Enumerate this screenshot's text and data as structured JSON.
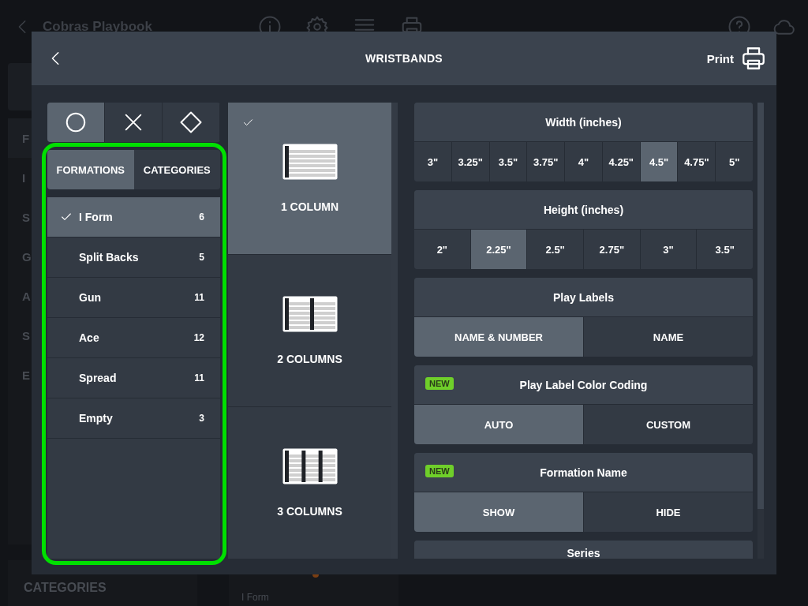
{
  "background": {
    "title": "Cobras Playbook",
    "sidebar_items": [
      {
        "label": "F",
        "kind": "header"
      },
      {
        "label": "I",
        "kind": "item"
      },
      {
        "label": "S",
        "kind": "item"
      },
      {
        "label": "G",
        "kind": "item"
      },
      {
        "label": "A",
        "kind": "item"
      },
      {
        "label": "S",
        "kind": "item"
      },
      {
        "label": "E",
        "kind": "item"
      }
    ],
    "categories_label": "CATEGORIES",
    "card": {
      "formation": "I Form"
    }
  },
  "dialog": {
    "title": "WRISTBANDS",
    "print_label": "Print"
  },
  "shape_tabs": [
    {
      "kind": "circle",
      "selected": true
    },
    {
      "kind": "cross",
      "selected": false
    },
    {
      "kind": "diamond",
      "selected": false
    }
  ],
  "list_tabs": [
    {
      "label": "FORMATIONS",
      "selected": true
    },
    {
      "label": "CATEGORIES",
      "selected": false
    }
  ],
  "formations": [
    {
      "name": "I Form",
      "count": "6",
      "selected": true
    },
    {
      "name": "Split Backs",
      "count": "5",
      "selected": false
    },
    {
      "name": "Gun",
      "count": "11",
      "selected": false
    },
    {
      "name": "Ace",
      "count": "12",
      "selected": false
    },
    {
      "name": "Spread",
      "count": "11",
      "selected": false
    },
    {
      "name": "Empty",
      "count": "3",
      "selected": false
    }
  ],
  "layouts": [
    {
      "label": "1 COLUMN",
      "kind": "one",
      "selected": true
    },
    {
      "label": "2 COLUMNS",
      "kind": "two",
      "selected": false
    },
    {
      "label": "3 COLUMNS",
      "kind": "three",
      "selected": false
    }
  ],
  "settings": [
    {
      "title": "Width (inches)",
      "new": false,
      "options": [
        {
          "label": "3\"",
          "selected": false
        },
        {
          "label": "3.25\"",
          "selected": false
        },
        {
          "label": "3.5\"",
          "selected": false
        },
        {
          "label": "3.75\"",
          "selected": false
        },
        {
          "label": "4\"",
          "selected": false
        },
        {
          "label": "4.25\"",
          "selected": false
        },
        {
          "label": "4.5\"",
          "selected": true
        },
        {
          "label": "4.75\"",
          "selected": false
        },
        {
          "label": "5\"",
          "selected": false
        }
      ]
    },
    {
      "title": "Height (inches)",
      "new": false,
      "options": [
        {
          "label": "2\"",
          "selected": false
        },
        {
          "label": "2.25\"",
          "selected": true
        },
        {
          "label": "2.5\"",
          "selected": false
        },
        {
          "label": "2.75\"",
          "selected": false
        },
        {
          "label": "3\"",
          "selected": false
        },
        {
          "label": "3.5\"",
          "selected": false
        }
      ]
    },
    {
      "title": "Play Labels",
      "new": false,
      "options": [
        {
          "label": "NAME & NUMBER",
          "selected": true
        },
        {
          "label": "NAME",
          "selected": false
        }
      ]
    },
    {
      "title": "Play Label Color Coding",
      "new": true,
      "badge": "NEW",
      "options": [
        {
          "label": "AUTO",
          "selected": true
        },
        {
          "label": "CUSTOM",
          "selected": false
        }
      ]
    },
    {
      "title": "Formation Name",
      "new": true,
      "badge": "NEW",
      "options": [
        {
          "label": "SHOW",
          "selected": true
        },
        {
          "label": "HIDE",
          "selected": false
        }
      ]
    },
    {
      "title": "Series",
      "new": false
    }
  ]
}
